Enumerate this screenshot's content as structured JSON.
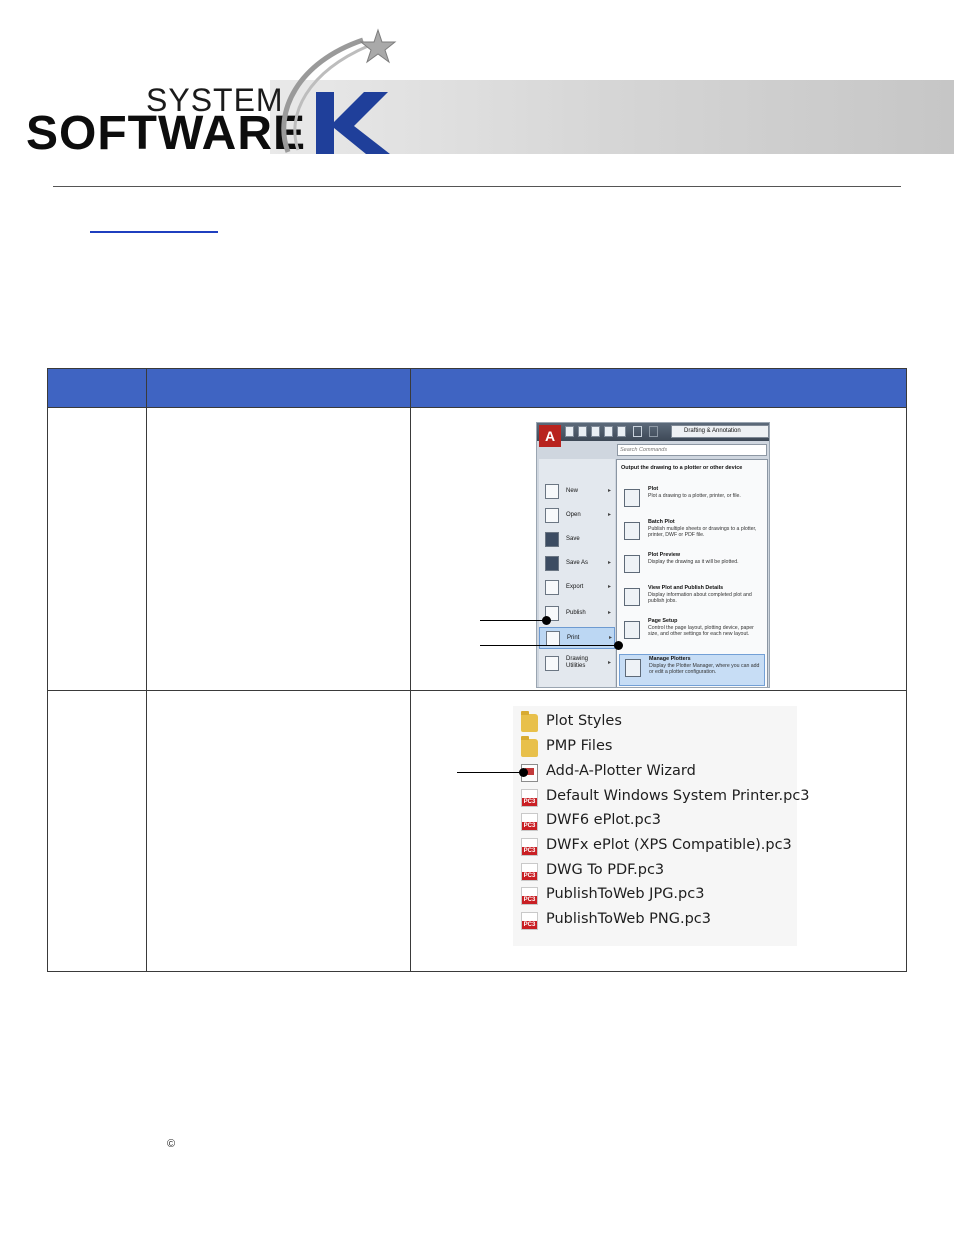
{
  "header": {
    "logo_line1": "SYSTEM",
    "logo_line2": "SOFTWARE",
    "logo_letter": "K",
    "colors": {
      "logo_blue": "#1f3f9a",
      "header_band": "#d4d4d4",
      "table_header": "#3f64c2"
    }
  },
  "cad_menu": {
    "app_icon": "A",
    "workspace": "Drafting & Annotation",
    "search_placeholder": "Search Commands",
    "left_items": [
      {
        "label": "New",
        "icon": "new-file-icon"
      },
      {
        "label": "Open",
        "icon": "open-folder-icon"
      },
      {
        "label": "Save",
        "icon": "save-disk-icon"
      },
      {
        "label": "Save As",
        "icon": "save-as-icon"
      },
      {
        "label": "Export",
        "icon": "export-icon"
      },
      {
        "label": "Publish",
        "icon": "publish-icon"
      },
      {
        "label": "Print",
        "icon": "printer-icon"
      },
      {
        "label": "Drawing Utilities",
        "icon": "drawing-utilities-icon"
      }
    ],
    "panel_title": "Output the drawing to a plotter or other device",
    "entries": [
      {
        "title": "Plot",
        "desc": "Plot a drawing to a plotter, printer, or file."
      },
      {
        "title": "Batch Plot",
        "desc": "Publish multiple sheets or drawings to a plotter, printer, DWF or PDF file."
      },
      {
        "title": "Plot Preview",
        "desc": "Display the drawing as it will be plotted."
      },
      {
        "title": "View Plot and Publish Details",
        "desc": "Display information about completed plot and publish jobs."
      },
      {
        "title": "Page Setup",
        "desc": "Control the page layout, plotting device, paper size, and other settings for each new layout."
      },
      {
        "title": "Manage Plotters",
        "desc": "Display the Plotter Manager, where you can add or edit a plotter configuration."
      }
    ]
  },
  "file_list": [
    {
      "name": "Plot Styles",
      "icon": "folder-icon"
    },
    {
      "name": "PMP Files",
      "icon": "folder-icon"
    },
    {
      "name": "Add-A-Plotter Wizard",
      "icon": "wizard-icon"
    },
    {
      "name": "Default Windows System Printer.pc3",
      "icon": "pc3-file-icon"
    },
    {
      "name": "DWF6 ePlot.pc3",
      "icon": "pc3-file-icon"
    },
    {
      "name": "DWFx ePlot (XPS Compatible).pc3",
      "icon": "pc3-file-icon"
    },
    {
      "name": "DWG To PDF.pc3",
      "icon": "pc3-file-icon"
    },
    {
      "name": "PublishToWeb JPG.pc3",
      "icon": "pc3-file-icon"
    },
    {
      "name": "PublishToWeb PNG.pc3",
      "icon": "pc3-file-icon"
    }
  ],
  "footer": {
    "copyright_symbol": "©"
  }
}
